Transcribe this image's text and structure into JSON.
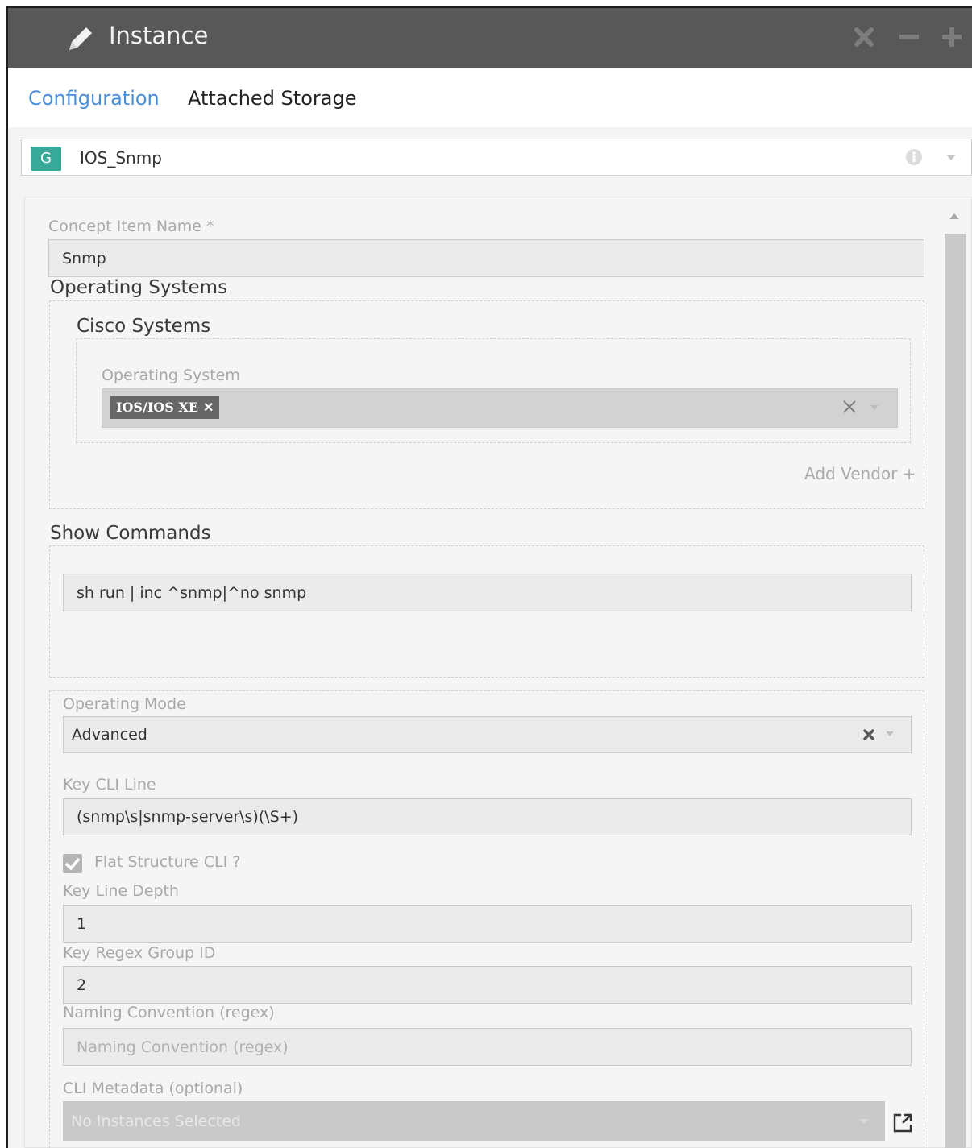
{
  "window": {
    "title": "Instance",
    "icons": [
      "pencil-icon",
      "close-icon",
      "minimize-icon",
      "maximize-icon"
    ]
  },
  "tabs": [
    {
      "label": "Configuration",
      "active": true
    },
    {
      "label": "Attached Storage",
      "active": false
    }
  ],
  "selector": {
    "badge": "G",
    "name": "IOS_Snmp",
    "badge_color": "#38a898"
  },
  "form": {
    "concept_item_name": {
      "label": "Concept Item Name *",
      "value": "Snmp"
    },
    "operating_systems": {
      "title": "Operating Systems",
      "vendor": {
        "title": "Cisco Systems",
        "os_label": "Operating System",
        "selected": [
          "IOS/IOS XE"
        ]
      },
      "add_vendor": "Add Vendor +"
    },
    "show_commands": {
      "title": "Show Commands",
      "value": "sh run | inc ^snmp|^no snmp"
    },
    "operating_mode": {
      "label": "Operating Mode",
      "value": "Advanced"
    },
    "key_cli_line": {
      "label": "Key CLI Line",
      "value": "(snmp\\s|snmp-server\\s)(\\S+)"
    },
    "flat_structure": {
      "label": "Flat Structure CLI ?",
      "checked": true
    },
    "key_line_depth": {
      "label": "Key Line Depth",
      "value": "1"
    },
    "key_regex_group_id": {
      "label": "Key Regex Group ID",
      "value": "2"
    },
    "naming_convention": {
      "label": "Naming Convention (regex)",
      "placeholder": "Naming Convention (regex)"
    },
    "cli_metadata": {
      "label": "CLI Metadata (optional)",
      "placeholder": "No Instances Selected"
    }
  },
  "colors": {
    "titlebar": "#585858",
    "active_tab": "#4a8ed8"
  }
}
